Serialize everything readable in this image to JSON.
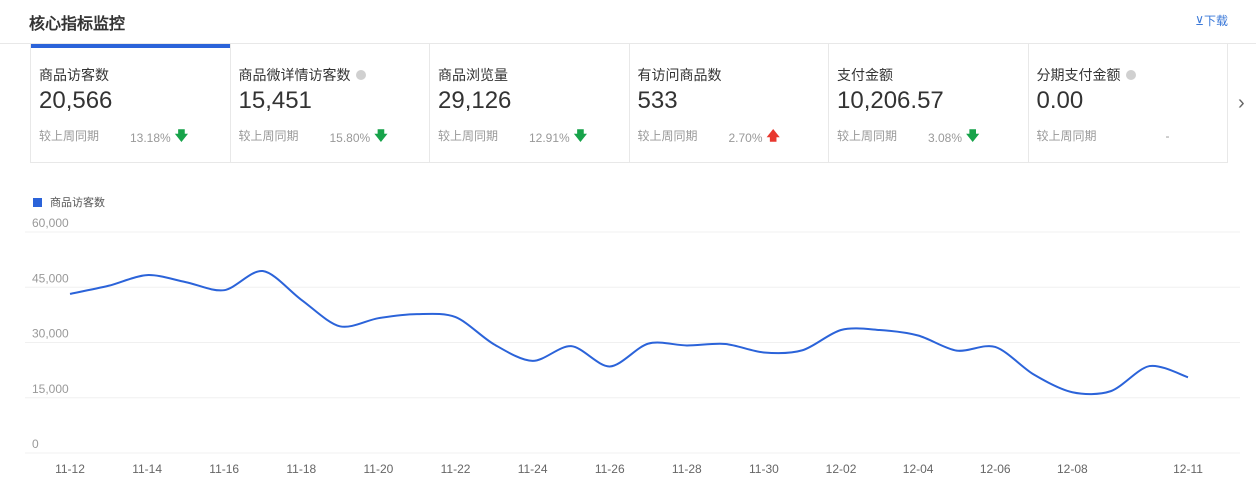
{
  "header": {
    "title": "核心指标监控",
    "download_label": "⊻下载"
  },
  "cards": [
    {
      "label": "商品访客数",
      "value": "20,566",
      "compare_label": "较上周同期",
      "compare_value": "13.18%",
      "trend": "down",
      "info": false,
      "active": true
    },
    {
      "label": "商品微详情访客数",
      "value": "15,451",
      "compare_label": "较上周同期",
      "compare_value": "15.80%",
      "trend": "down",
      "info": true
    },
    {
      "label": "商品浏览量",
      "value": "29,126",
      "compare_label": "较上周同期",
      "compare_value": "12.91%",
      "trend": "down",
      "info": false
    },
    {
      "label": "有访问商品数",
      "value": "533",
      "compare_label": "较上周同期",
      "compare_value": "2.70%",
      "trend": "up",
      "info": false
    },
    {
      "label": "支付金额",
      "value": "10,206.57",
      "compare_label": "较上周同期",
      "compare_value": "3.08%",
      "trend": "down",
      "info": false
    },
    {
      "label": "分期支付金额",
      "value": "0.00",
      "compare_label": "较上周同期",
      "compare_value": "-",
      "trend": "none",
      "info": true
    }
  ],
  "chart_data": {
    "type": "line",
    "legend": "商品访客数",
    "legend_position": "top-left",
    "color": "#2b63d9",
    "x": [
      "11-12",
      "11-13",
      "11-14",
      "11-15",
      "11-16",
      "11-17",
      "11-18",
      "11-19",
      "11-20",
      "11-21",
      "11-22",
      "11-23",
      "11-24",
      "11-25",
      "11-26",
      "11-27",
      "11-28",
      "11-29",
      "11-30",
      "12-01",
      "12-02",
      "12-03",
      "12-04",
      "12-05",
      "12-06",
      "12-07",
      "12-08",
      "12-09",
      "12-10",
      "12-11"
    ],
    "values": [
      43200,
      45400,
      48300,
      46400,
      44200,
      49400,
      41600,
      34400,
      36600,
      37700,
      36900,
      29500,
      25000,
      29000,
      23500,
      29700,
      29200,
      29600,
      27300,
      27900,
      33400,
      33400,
      31900,
      27800,
      28800,
      21300,
      16500,
      16800,
      23600,
      20566
    ],
    "x_tick_labels": [
      "11-12",
      "11-14",
      "11-16",
      "11-18",
      "11-20",
      "11-22",
      "11-24",
      "11-26",
      "11-28",
      "11-30",
      "12-02",
      "12-04",
      "12-06",
      "12-08",
      "12-11"
    ],
    "y_ticks": [
      "0",
      "15,000",
      "30,000",
      "45,000",
      "60,000"
    ],
    "ylim": [
      0,
      60000
    ],
    "grid": true
  }
}
